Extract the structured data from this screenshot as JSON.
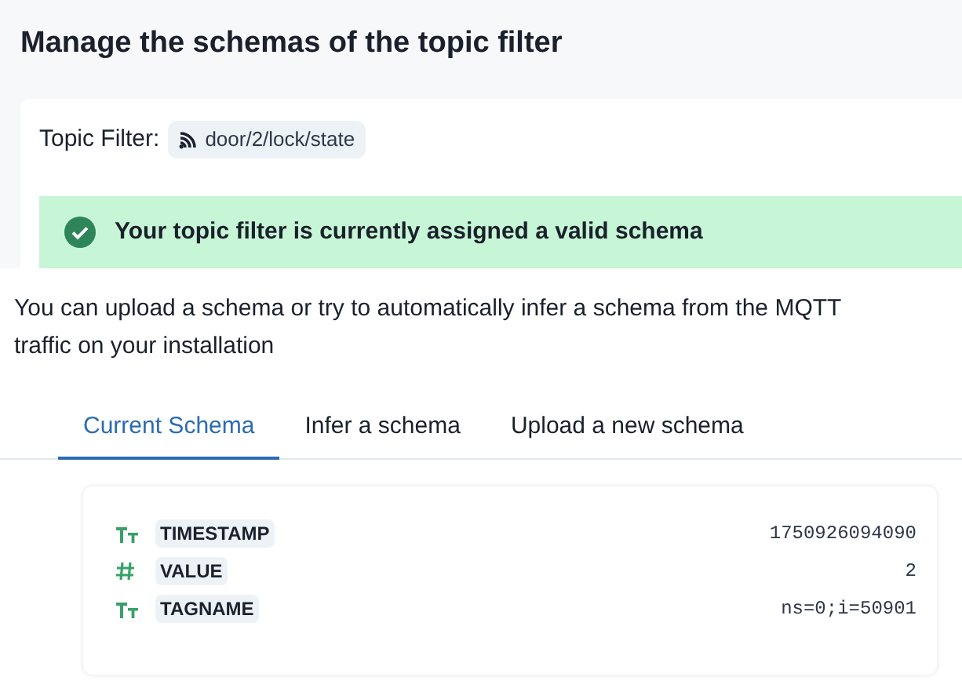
{
  "title": "Manage the schemas of the topic filter",
  "topic_filter": {
    "label": "Topic Filter:",
    "value": "door/2/lock/state"
  },
  "alert": {
    "valid": true,
    "message": "Your topic filter is currently assigned a valid schema"
  },
  "description": "You can upload a schema or try to automatically infer a schema from the MQTT traffic on your installation",
  "tabs": [
    {
      "label": "Current Schema",
      "selected": true
    },
    {
      "label": "Infer a schema",
      "selected": false
    },
    {
      "label": "Upload a new schema",
      "selected": false
    }
  ],
  "schema_fields": [
    {
      "kind": "string",
      "name": "TIMESTAMP",
      "value": "1750926094090"
    },
    {
      "kind": "number",
      "name": "VALUE",
      "value": "2"
    },
    {
      "kind": "string",
      "name": "TAGNAME",
      "value": "ns=0;i=50901"
    }
  ]
}
